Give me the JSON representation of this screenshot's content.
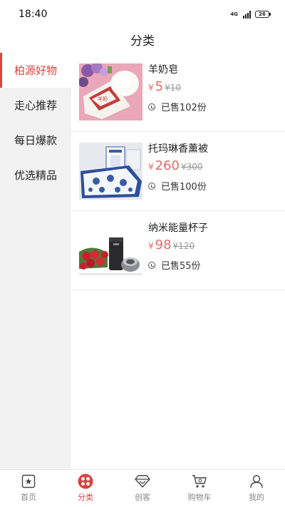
{
  "status_bar": {
    "time": "18:40",
    "network": "4G",
    "battery": "26"
  },
  "header": {
    "title": "分类"
  },
  "sidebar": {
    "items": [
      {
        "label": "柏源好物",
        "active": true
      },
      {
        "label": "走心推荐",
        "active": false
      },
      {
        "label": "每日爆款",
        "active": false
      },
      {
        "label": "优选精品",
        "active": false
      }
    ]
  },
  "products": [
    {
      "name": "羊奶皂",
      "currency": "¥",
      "price": "5",
      "original_price": "¥10",
      "sold": "已售102份",
      "image_icon": "goat-milk-soap-image"
    },
    {
      "name": "托玛琳香薰被",
      "currency": "¥",
      "price": "260",
      "original_price": "¥300",
      "sold": "已售100份",
      "image_icon": "tourmaline-quilt-image"
    },
    {
      "name": "纳米能量杯子",
      "currency": "¥",
      "price": "98",
      "original_price": "¥120",
      "sold": "已售55份",
      "image_icon": "nano-energy-cup-image"
    }
  ],
  "bottom_nav": {
    "items": [
      {
        "label": "首页",
        "icon": "home-icon",
        "active": false
      },
      {
        "label": "分类",
        "icon": "category-icon",
        "active": true
      },
      {
        "label": "创客",
        "icon": "maker-diamond-icon",
        "active": false
      },
      {
        "label": "购物车",
        "icon": "cart-icon",
        "active": false
      },
      {
        "label": "我的",
        "icon": "profile-icon",
        "active": false
      }
    ]
  },
  "colors": {
    "accent": "#d9443f",
    "price": "#e26c64",
    "sidebar_bg": "#f2f2f2"
  }
}
